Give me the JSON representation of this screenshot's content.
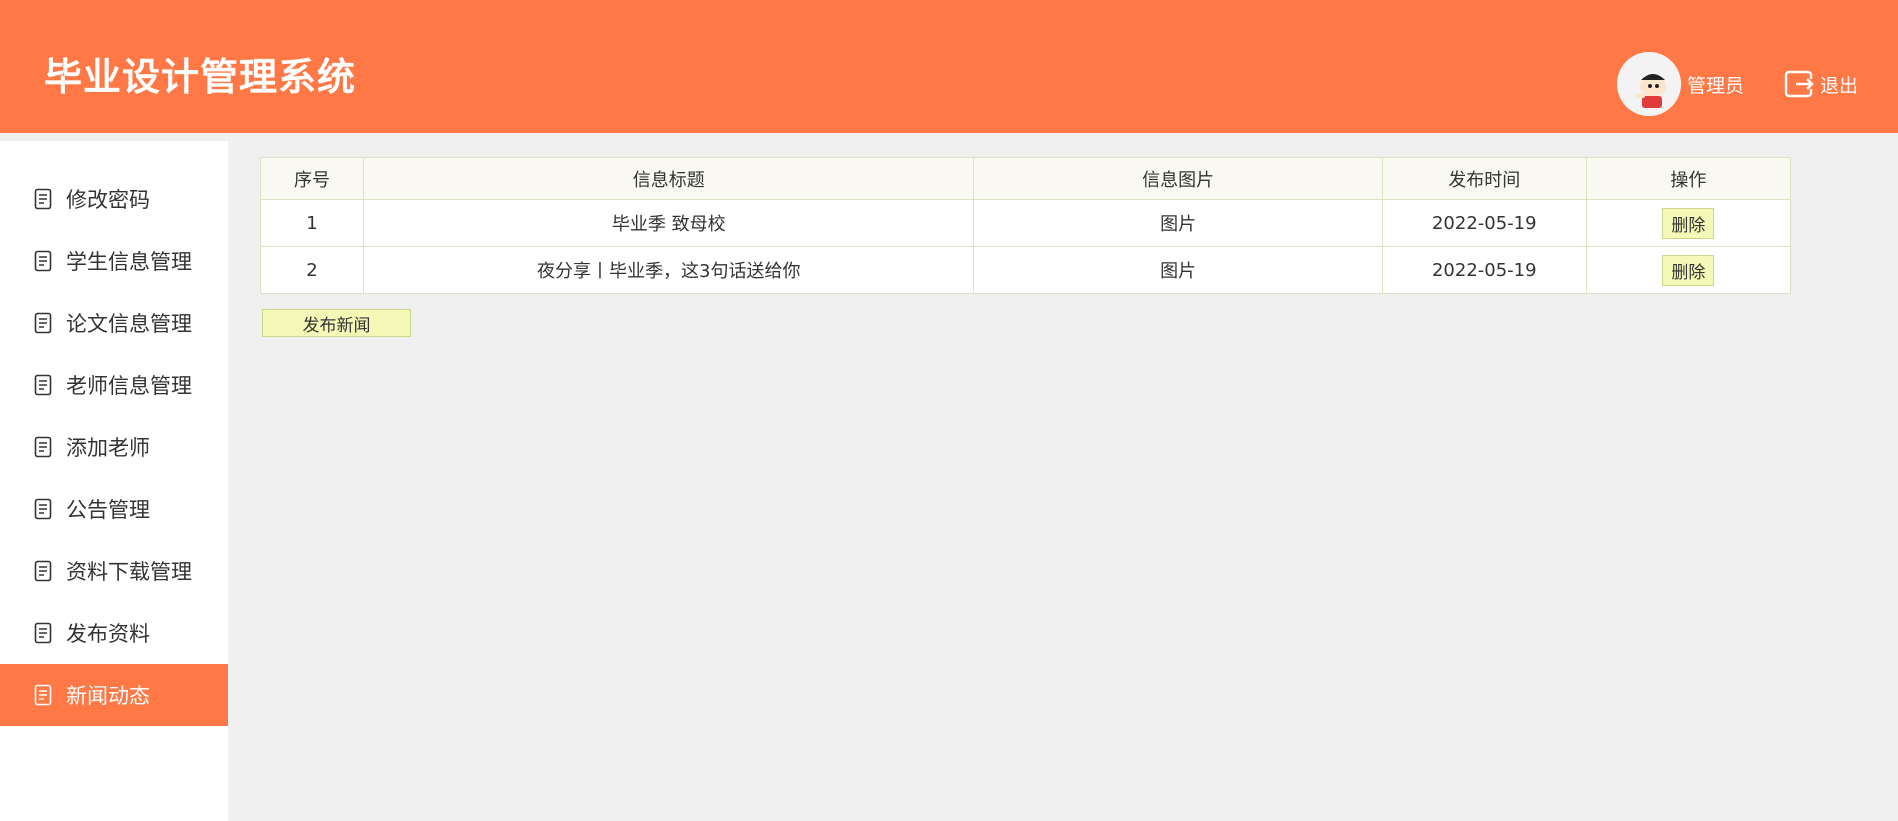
{
  "header": {
    "title": "毕业设计管理系统",
    "user_name": "管理员",
    "logout_label": "退出",
    "bg_color": "#ff7845"
  },
  "sidebar": {
    "items": [
      {
        "label": "修改密码",
        "icon": "document-icon"
      },
      {
        "label": "学生信息管理",
        "icon": "document-icon"
      },
      {
        "label": "论文信息管理",
        "icon": "document-icon"
      },
      {
        "label": "老师信息管理",
        "icon": "document-icon"
      },
      {
        "label": "添加老师",
        "icon": "document-icon"
      },
      {
        "label": "公告管理",
        "icon": "document-icon"
      },
      {
        "label": "资料下载管理",
        "icon": "document-icon"
      },
      {
        "label": "发布资料",
        "icon": "document-icon"
      },
      {
        "label": "新闻动态",
        "icon": "document-icon",
        "active": true
      }
    ]
  },
  "table": {
    "columns": [
      "序号",
      "信息标题",
      "信息图片",
      "发布时间",
      "操作"
    ],
    "rows": [
      {
        "index": "1",
        "title": "毕业季 致母校",
        "image": "图片",
        "date": "2022-05-19",
        "action": "删除"
      },
      {
        "index": "2",
        "title": "夜分享丨毕业季，这3句话送给你",
        "image": "图片",
        "date": "2022-05-19",
        "action": "删除"
      }
    ]
  },
  "actions": {
    "publish_label": "发布新闻"
  }
}
